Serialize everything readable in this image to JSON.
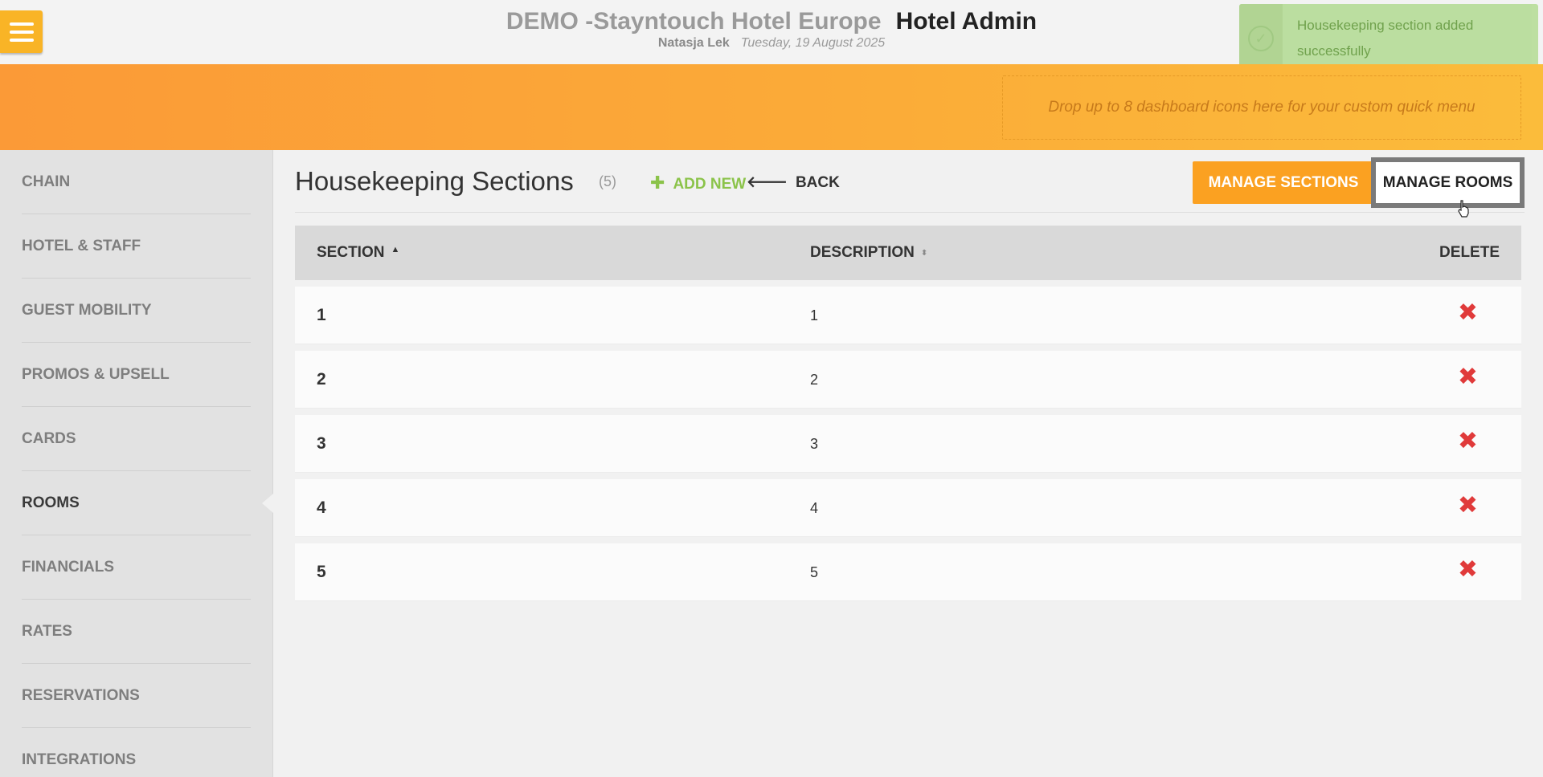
{
  "header": {
    "hotel_name": "DEMO -Stayntouch Hotel Europe",
    "app_name": "Hotel Admin",
    "user": "Natasja Lek",
    "date": "Tuesday, 19 August 2025",
    "menu_icon": "hamburger-icon"
  },
  "toast": {
    "message": "Housekeeping section added successfully",
    "icon": "check-circle-icon"
  },
  "quick_menu": {
    "placeholder": "Drop up to 8 dashboard icons here for your custom quick menu"
  },
  "sidebar": {
    "items": [
      {
        "label": "CHAIN"
      },
      {
        "label": "HOTEL & STAFF"
      },
      {
        "label": "GUEST MOBILITY"
      },
      {
        "label": "PROMOS & UPSELL"
      },
      {
        "label": "CARDS"
      },
      {
        "label": "ROOMS",
        "active": true
      },
      {
        "label": "FINANCIALS"
      },
      {
        "label": "RATES"
      },
      {
        "label": "RESERVATIONS"
      },
      {
        "label": "INTEGRATIONS"
      }
    ]
  },
  "page": {
    "title": "Housekeeping Sections",
    "count": "(5)",
    "add_new": "ADD NEW",
    "back": "BACK",
    "manage_sections": "MANAGE SECTIONS",
    "manage_rooms": "MANAGE ROOMS"
  },
  "table": {
    "headers": {
      "section": "SECTION",
      "description": "DESCRIPTION",
      "delete": "DELETE"
    },
    "rows": [
      {
        "section": "1",
        "description": "1"
      },
      {
        "section": "2",
        "description": "2"
      },
      {
        "section": "3",
        "description": "3"
      },
      {
        "section": "4",
        "description": "4"
      },
      {
        "section": "5",
        "description": "5"
      }
    ],
    "delete_icon": "close-x-icon"
  },
  "colors": {
    "accent_orange": "#fba121",
    "success_green": "#8bc34a",
    "delete_red": "#e03a3a"
  }
}
